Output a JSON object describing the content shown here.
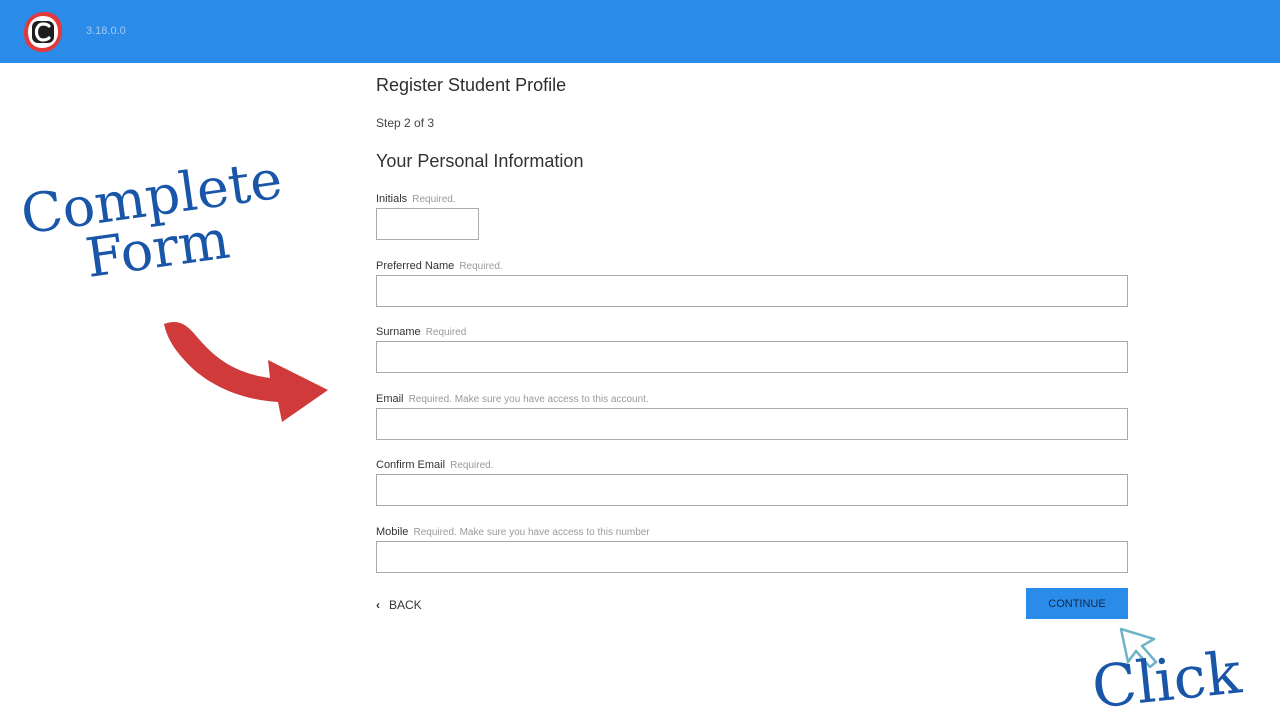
{
  "header": {
    "version": "3.18.0.0",
    "brand_color": "#2b8be8"
  },
  "form": {
    "page_title": "Register Student Profile",
    "step": "Step 2 of 3",
    "section_title": "Your Personal Information",
    "fields": {
      "initials": {
        "label": "Initials",
        "hint": "Required.",
        "value": ""
      },
      "preferred_name": {
        "label": "Preferred Name",
        "hint": "Required.",
        "value": ""
      },
      "surname": {
        "label": "Surname",
        "hint": "Required",
        "value": ""
      },
      "email": {
        "label": "Email",
        "hint": "Required. Make sure you have access to this account.",
        "value": ""
      },
      "confirm_email": {
        "label": "Confirm Email",
        "hint": "Required.",
        "value": ""
      },
      "mobile": {
        "label": "Mobile",
        "hint": "Required. Make sure you have access to this number",
        "value": ""
      }
    },
    "back_label": "BACK",
    "continue_label": "CONTINUE"
  },
  "annotations": {
    "complete_line1": "Complete",
    "complete_line2": "Form",
    "click": "Click",
    "arrow_color": "#d13a3a",
    "annotation_color": "#1a56a8"
  },
  "icons": {
    "logo": "app-logo-icon",
    "back": "chevron-left-icon",
    "arrow": "red-arrow-icon",
    "cursor": "mouse-pointer-icon"
  }
}
